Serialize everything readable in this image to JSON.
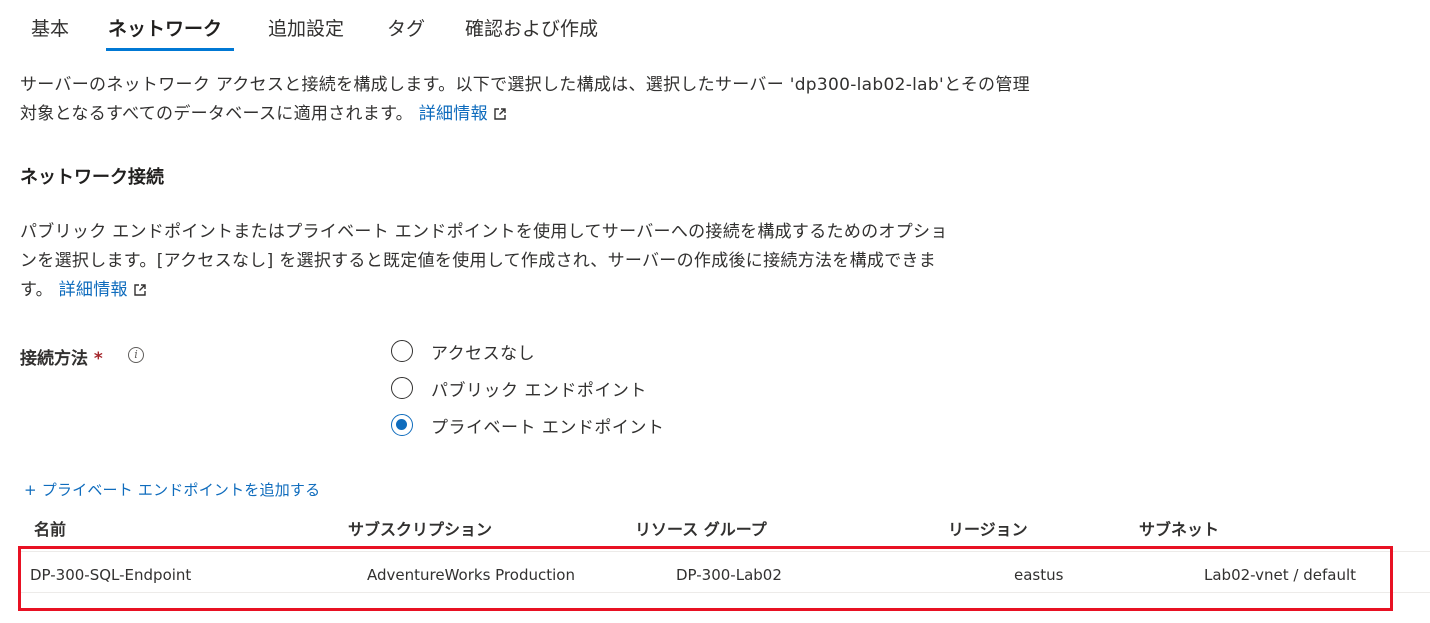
{
  "tabs": [
    {
      "label": "基本"
    },
    {
      "label": "ネットワーク",
      "active": true
    },
    {
      "label": "追加設定"
    },
    {
      "label": "タグ"
    },
    {
      "label": "確認および作成"
    }
  ],
  "intro": {
    "line1": "サーバーのネットワーク アクセスと接続を構成します。以下で選択した構成は、選択したサーバー 'dp300-lab02-lab'とその管理",
    "line2": "対象となるすべてのデータベースに適用されます。",
    "link": "詳細情報"
  },
  "network_section": {
    "heading": "ネットワーク接続",
    "desc_line1": "パブリック エンドポイントまたはプライベート エンドポイントを使用してサーバーへの接続を構成するためのオプショ",
    "desc_line2": "ンを選択します。[アクセスなし] を選択すると既定値を使用して作成され、サーバーの作成後に接続方法を構成できま",
    "desc_line3": "す。",
    "link": "詳細情報"
  },
  "connection": {
    "label": "接続方法",
    "required_mark": "*",
    "info_glyph": "i",
    "options": [
      {
        "label": "アクセスなし",
        "selected": false
      },
      {
        "label": "パブリック エンドポイント",
        "selected": false
      },
      {
        "label": "プライベート エンドポイント",
        "selected": true
      }
    ]
  },
  "add_endpoint_label": "+ プライベート エンドポイントを追加する",
  "table": {
    "headers": [
      "名前",
      "サブスクリプション",
      "リソース グループ",
      "リージョン",
      "サブネット"
    ],
    "rows": [
      {
        "name": "DP-300-SQL-Endpoint",
        "subscription": "AdventureWorks Production",
        "resource_group": "DP-300-Lab02",
        "region": "eastus",
        "subnet": "Lab02-vnet / default"
      }
    ]
  },
  "colors": {
    "accent": "#0078d4",
    "link": "#0f6cbd",
    "highlight": "#e81123",
    "required": "#a4262c"
  }
}
